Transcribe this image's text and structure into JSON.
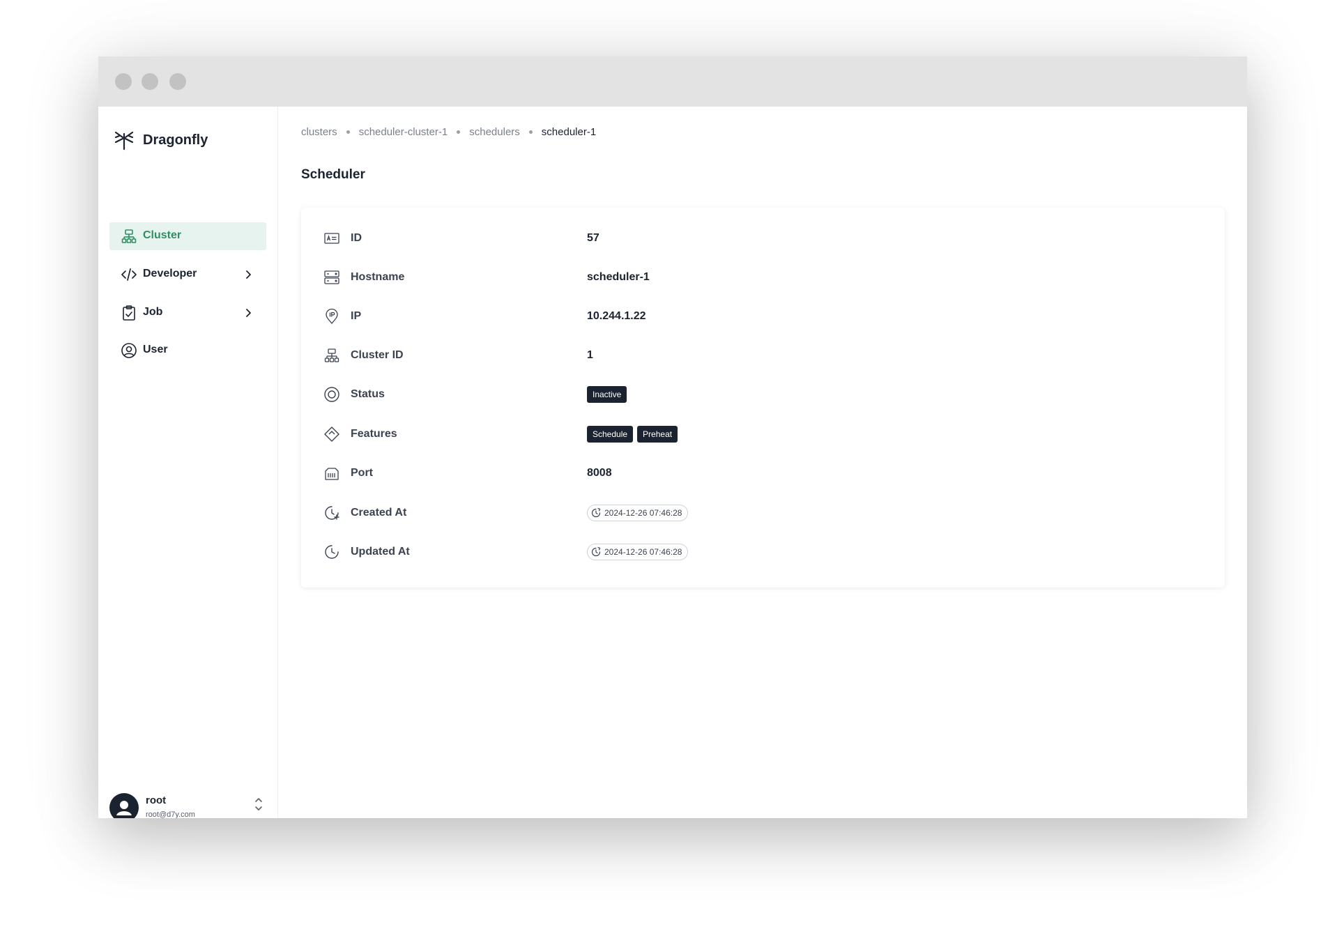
{
  "app": {
    "brand": "Dragonfly"
  },
  "sidebar": {
    "items": [
      {
        "label": "Cluster",
        "icon": "cluster-icon",
        "active": true
      },
      {
        "label": "Developer",
        "icon": "code-icon",
        "expandable": true
      },
      {
        "label": "Job",
        "icon": "clipboard-check-icon",
        "expandable": true
      },
      {
        "label": "User",
        "icon": "user-circle-icon"
      }
    ],
    "user": {
      "name": "root",
      "email": "root@d7y.com"
    }
  },
  "breadcrumb": [
    "clusters",
    "scheduler-cluster-1",
    "schedulers",
    "scheduler-1"
  ],
  "page": {
    "title": "Scheduler"
  },
  "details": {
    "id": {
      "label": "ID",
      "value": "57",
      "icon": "id-card-icon"
    },
    "hostname": {
      "label": "Hostname",
      "value": "scheduler-1",
      "icon": "server-icon"
    },
    "ip": {
      "label": "IP",
      "value": "10.244.1.22",
      "icon": "ip-pin-icon"
    },
    "cluster_id": {
      "label": "Cluster ID",
      "value": "1",
      "icon": "cluster-icon"
    },
    "status": {
      "label": "Status",
      "value": "Inactive",
      "icon": "status-ring-icon"
    },
    "features": {
      "label": "Features",
      "values": [
        "Schedule",
        "Preheat"
      ],
      "icon": "features-icon"
    },
    "port": {
      "label": "Port",
      "value": "8008",
      "icon": "port-icon"
    },
    "created_at": {
      "label": "Created At",
      "value": "2024-12-26 07:46:28",
      "icon": "clock-plus-icon"
    },
    "updated_at": {
      "label": "Updated At",
      "value": "2024-12-26 07:46:28",
      "icon": "clock-icon"
    }
  },
  "colors": {
    "accent": "#2e8f63",
    "accent_bg": "#e7f3ee",
    "chip_bg": "#1c2330",
    "text": "#1c2330"
  }
}
